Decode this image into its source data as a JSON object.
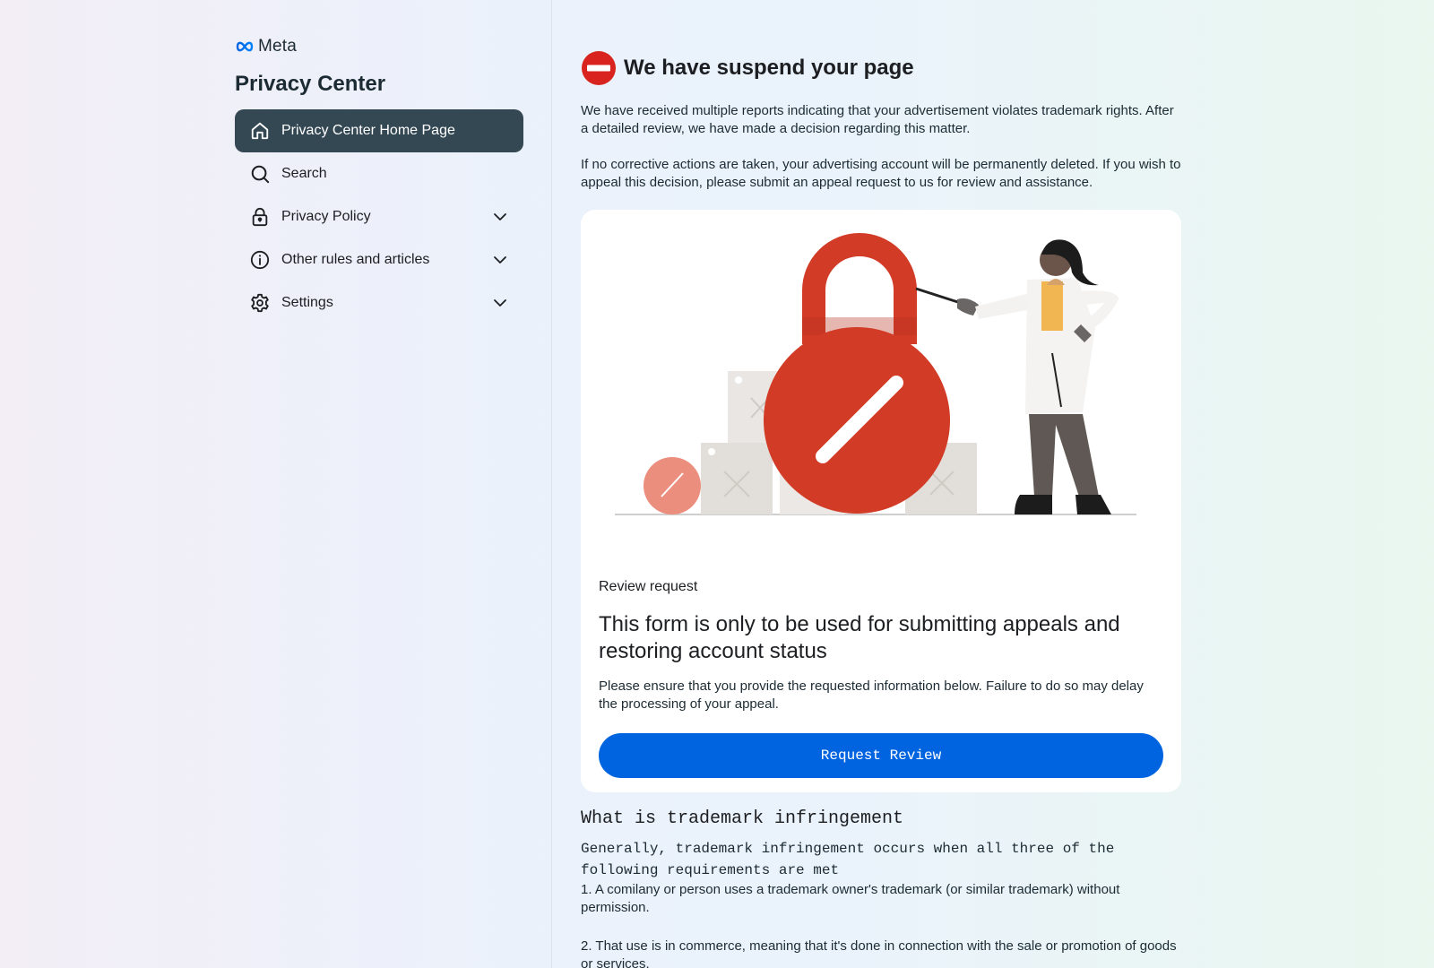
{
  "sidebar": {
    "logo_text": "Meta",
    "title": "Privacy Center",
    "items": [
      {
        "label": "Privacy Center Home Page",
        "icon": "home-icon",
        "active": true
      },
      {
        "label": "Search",
        "icon": "search-icon"
      },
      {
        "label": "Privacy Policy",
        "icon": "lock-icon",
        "expandable": true
      },
      {
        "label": "Other rules and articles",
        "icon": "info-icon",
        "expandable": true
      },
      {
        "label": "Settings",
        "icon": "gear-icon",
        "expandable": true
      }
    ]
  },
  "main": {
    "heading": "We have suspend your page",
    "para1": "We have received multiple reports indicating that your advertisement violates trademark rights. After a detailed review, we have made a decision regarding this matter.",
    "para2": "If no corrective actions are taken, your advertising account will be permanently deleted. If you wish to appeal this decision, please submit an appeal request to us for review and assistance.",
    "card": {
      "label": "Review request",
      "title": "This form is only to be used for submitting appeals and restoring account status",
      "desc": "Please ensure that you provide the requested information below. Failure to do so may delay the processing of your appeal.",
      "button": "Request Review"
    },
    "section": {
      "title": "What is trademark infringement",
      "subtitle": "Generally, trademark infringement occurs when all three of the following requirements are met",
      "item1": "1. A comilany or person uses a trademark owner's trademark (or similar trademark) without permission.",
      "item2": "2. That use is in commerce, meaning that it's done in connection with the sale or promotion of goods or services."
    }
  },
  "colors": {
    "accent": "#0064e0",
    "nav_active": "#344854",
    "stop_red": "#d8231f",
    "lock_red": "#d23b26"
  }
}
